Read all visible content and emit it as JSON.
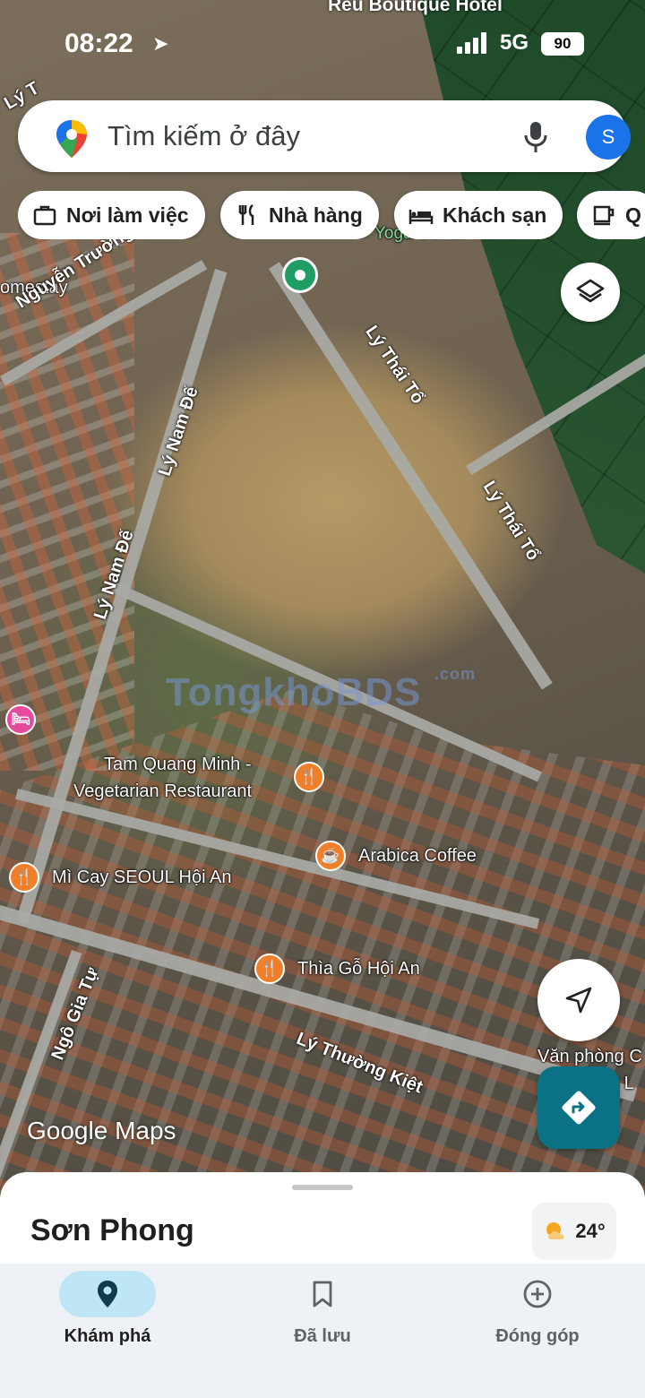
{
  "status_bar": {
    "time": "08:22",
    "network": "5G",
    "battery": "90"
  },
  "search": {
    "placeholder": "Tìm kiếm ở đây",
    "avatar_initial": "S"
  },
  "chips": [
    {
      "label": "Nơi làm việc",
      "icon": "briefcase-icon"
    },
    {
      "label": "Nhà hàng",
      "icon": "fork-knife-icon"
    },
    {
      "label": "Khách sạn",
      "icon": "bed-icon"
    },
    {
      "label": "Q",
      "icon": "cup-icon"
    }
  ],
  "map": {
    "hotel_label": "Reu Boutique Hotel",
    "yoga_label": "Yoga Center Hoi An",
    "homestay_label": "omestay",
    "streets": {
      "ly_top": "Lý T",
      "nguyen_truong_to": "Nguyễn Trường Tộ",
      "ly_nam_de_1": "Lý Nam Đế",
      "ly_nam_de_2": "Lý Nam Đế",
      "ly_thai_to_1": "Lý Thái Tổ",
      "ly_thai_to_2": "Lý Thái Tổ",
      "ngo_gia_tu": "Ngô Gia Tự",
      "ly_thuong_kiet": "Lý Thường Kiệt"
    },
    "pois": {
      "tam_quang_minh_1": "Tam Quang Minh -",
      "tam_quang_minh_2": "Vegetarian Restaurant",
      "arabica": "Arabica Coffee",
      "mi_cay": "Mì Cay SEOUL Hội An",
      "thia_go": "Thìa Gỗ Hội An",
      "van_phong_1": "Văn phòng C",
      "van_phong_2": "g L"
    },
    "watermark": "TongkhoBDS",
    "watermark_suffix": ".com",
    "attribution": "Google Maps"
  },
  "sheet": {
    "title": "Sơn Phong",
    "weather_temp": "24°"
  },
  "nav": [
    {
      "label": "Khám phá",
      "icon": "explore-pin-icon",
      "active": true
    },
    {
      "label": "Đã lưu",
      "icon": "bookmark-icon",
      "active": false
    },
    {
      "label": "Đóng góp",
      "icon": "add-circle-icon",
      "active": false
    }
  ],
  "colors": {
    "accent": "#1a73e8",
    "nav_active_bg": "#bfe6f4",
    "directions_btn": "#0b7285",
    "poi_orange": "#f07f2a",
    "poi_pink": "#e54b9c"
  }
}
